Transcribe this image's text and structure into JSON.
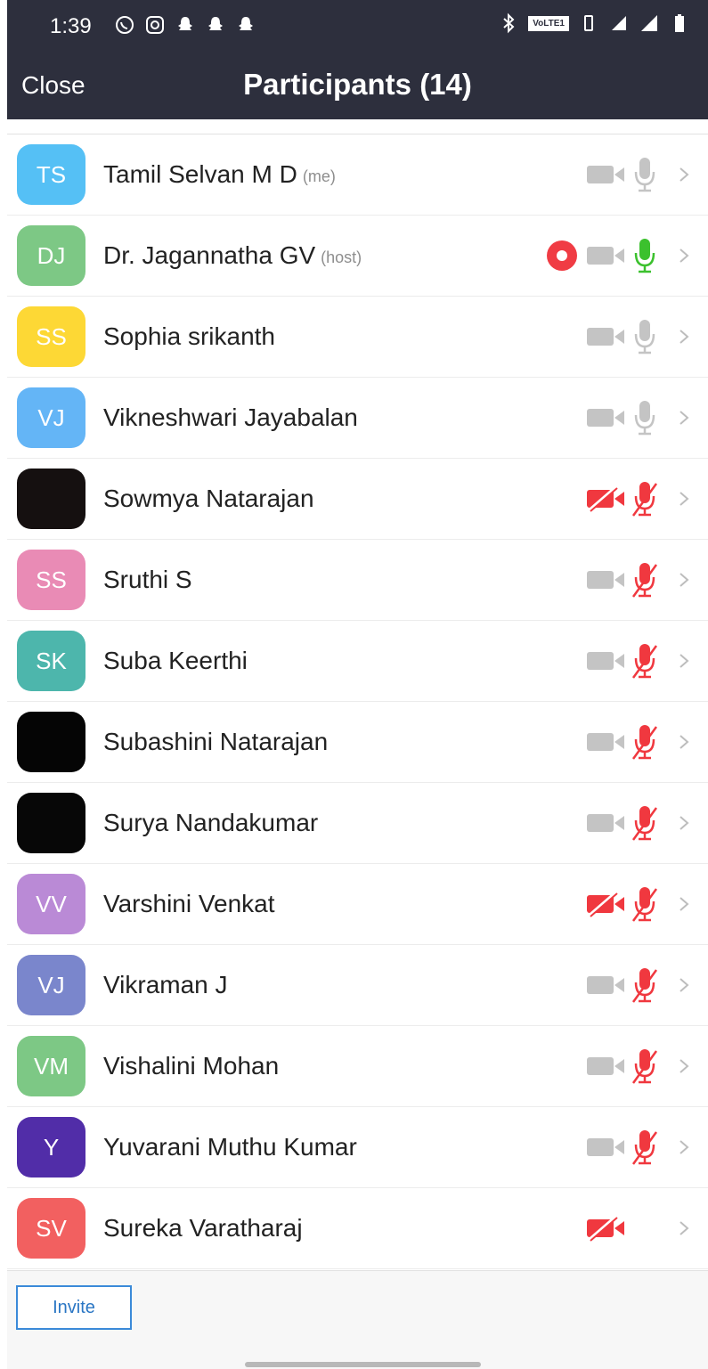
{
  "status_bar": {
    "time": "1:39",
    "left_icons": [
      "whatsapp-icon",
      "instagram-icon",
      "snapchat-icon",
      "snapchat-icon",
      "snapchat-icon"
    ],
    "volte_label": "VoLTE1",
    "right_icons": [
      "bluetooth-icon",
      "vibrate-icon",
      "data-4g-icon",
      "signal-icon",
      "battery-icon"
    ]
  },
  "header": {
    "close_label": "Close",
    "title": "Participants (14)"
  },
  "participants": [
    {
      "initials": "TS",
      "name": "Tamil Selvan M D",
      "tag": "(me)",
      "avatar_color": "#55c0f5",
      "recording": false,
      "video_off": false,
      "mic": "idle"
    },
    {
      "initials": "DJ",
      "name": "Dr. Jagannatha GV",
      "tag": "(host)",
      "avatar_color": "#7dc885",
      "recording": true,
      "video_off": false,
      "mic": "active"
    },
    {
      "initials": "SS",
      "name": "Sophia srikanth",
      "tag": "",
      "avatar_color": "#fdd835",
      "recording": false,
      "video_off": false,
      "mic": "idle"
    },
    {
      "initials": "VJ",
      "name": "Vikneshwari Jayabalan",
      "tag": "",
      "avatar_color": "#64b5f6",
      "recording": false,
      "video_off": false,
      "mic": "idle"
    },
    {
      "initials": "",
      "name": "Sowmya Natarajan",
      "tag": "",
      "avatar_color": "#151010",
      "recording": false,
      "video_off": true,
      "mic": "muted"
    },
    {
      "initials": "SS",
      "name": "Sruthi S",
      "tag": "",
      "avatar_color": "#e98bb5",
      "recording": false,
      "video_off": false,
      "mic": "muted"
    },
    {
      "initials": "SK",
      "name": "Suba Keerthi",
      "tag": "",
      "avatar_color": "#4db6ac",
      "recording": false,
      "video_off": false,
      "mic": "muted"
    },
    {
      "initials": "",
      "name": "Subashini Natarajan",
      "tag": "",
      "avatar_color": "#050505",
      "recording": false,
      "video_off": false,
      "mic": "muted"
    },
    {
      "initials": "",
      "name": "Surya Nandakumar",
      "tag": "",
      "avatar_color": "#070707",
      "recording": false,
      "video_off": false,
      "mic": "muted"
    },
    {
      "initials": "VV",
      "name": "Varshini Venkat",
      "tag": "",
      "avatar_color": "#ba8ad6",
      "recording": false,
      "video_off": true,
      "mic": "muted"
    },
    {
      "initials": "VJ",
      "name": "Vikraman J",
      "tag": "",
      "avatar_color": "#7a86cc",
      "recording": false,
      "video_off": false,
      "mic": "muted"
    },
    {
      "initials": "VM",
      "name": "Vishalini Mohan",
      "tag": "",
      "avatar_color": "#7dc885",
      "recording": false,
      "video_off": false,
      "mic": "muted"
    },
    {
      "initials": "Y",
      "name": "Yuvarani Muthu Kumar",
      "tag": "",
      "avatar_color": "#512da8",
      "recording": false,
      "video_off": false,
      "mic": "muted"
    },
    {
      "initials": "SV",
      "name": "Sureka Varatharaj",
      "tag": "",
      "avatar_color": "#f26060",
      "recording": false,
      "video_off": true,
      "mic": "none"
    }
  ],
  "footer": {
    "invite_label": "Invite"
  },
  "colors": {
    "header_bg": "#2d2f3d",
    "icon_gray": "#c4c4c4",
    "muted_red": "#f0383f",
    "active_green": "#3cc12e",
    "record_red": "#f03c44",
    "invite_blue": "#2a76c4"
  }
}
